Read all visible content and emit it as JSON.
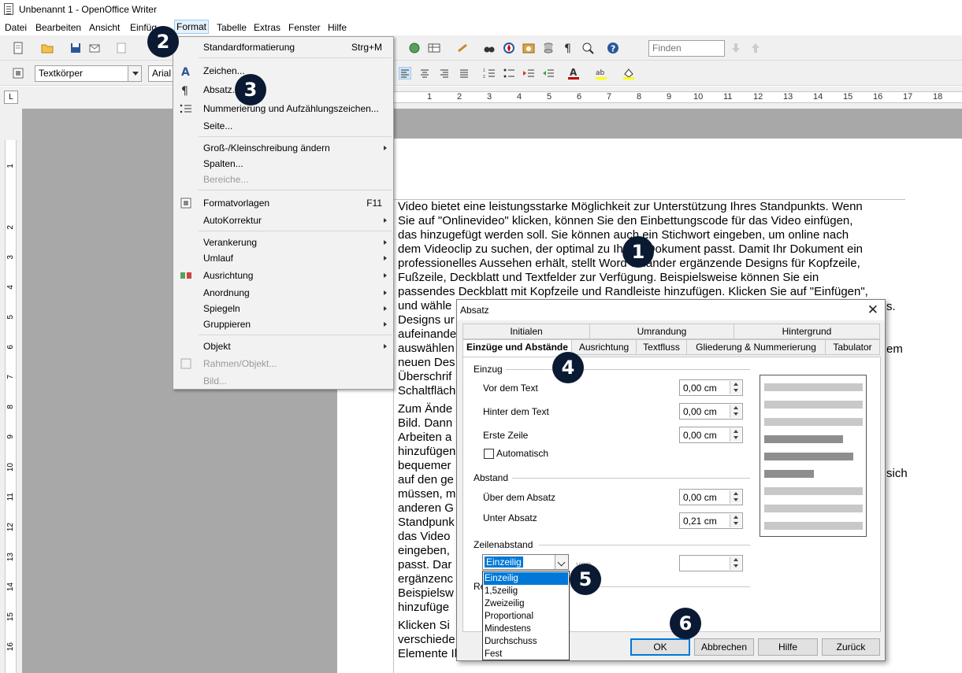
{
  "window": {
    "title": "Unbenannt 1 - OpenOffice Writer"
  },
  "menubar": [
    "Datei",
    "Bearbeiten",
    "Ansicht",
    "Einfüg",
    "Format",
    "Tabelle",
    "Extras",
    "Fenster",
    "Hilfe"
  ],
  "toolbar": {
    "paragraph_style": "Textkörper",
    "font_name": "Arial",
    "find_placeholder": "Finden"
  },
  "ruler": {
    "corner": "L",
    "numbers": [
      "1",
      "2",
      "3",
      "4",
      "5",
      "6",
      "7",
      "8",
      "9",
      "10",
      "11",
      "12",
      "13",
      "14",
      "15",
      "16",
      "17",
      "18"
    ],
    "vnumbers": [
      "1",
      "1",
      "2",
      "3",
      "4",
      "5",
      "6",
      "7",
      "8",
      "9",
      "10",
      "11",
      "12",
      "13",
      "14",
      "15",
      "16"
    ]
  },
  "format_menu": {
    "items": [
      {
        "label": "Standardformatierung",
        "shortcut": "Strg+M"
      },
      {
        "label": "Zeichen..."
      },
      {
        "label": "Absatz..."
      },
      {
        "label": "Nummerierung und Aufzählungszeichen..."
      },
      {
        "label": "Seite..."
      },
      {
        "label": "Groß-/Kleinschreibung ändern"
      },
      {
        "label": "Spalten..."
      },
      {
        "label": "Bereiche..."
      },
      {
        "label": "Formatvorlagen",
        "shortcut": "F11"
      },
      {
        "label": "AutoKorrektur"
      },
      {
        "label": "Verankerung"
      },
      {
        "label": "Umlauf"
      },
      {
        "label": "Ausrichtung"
      },
      {
        "label": "Anordnung"
      },
      {
        "label": "Spiegeln"
      },
      {
        "label": "Gruppieren"
      },
      {
        "label": "Objekt"
      },
      {
        "label": "Rahmen/Objekt..."
      },
      {
        "label": "Bild..."
      }
    ]
  },
  "document": {
    "p1": "Video bietet eine leistungsstarke Möglichkeit zur Unterstützung Ihres Standpunkts. Wenn\nSie auf \"Onlinevideo\" klicken, können Sie den Einbettungscode für das Video einfügen,\ndas hinzugefügt werden soll. Sie können auch ein Stichwort eingeben, um online nach\ndem Videoclip zu suchen, der optimal zu Ihrem Dokument passt. Damit Ihr Dokument ein\nprofessionelles Aussehen erhält, stellt Word einander ergänzende Designs für Kopfzeile,\nFußzeile, Deckblatt und Textfelder zur Verfügung. Beispielsweise können Sie ein\npassendes Deckblatt mit Kopfzeile und Randleiste hinzufügen. Klicken Sie auf \"Einfügen\",\nund wähle\nDesigns ur\naufeinande\nauswählen\nneuen Des\nÜberschrif\nSchaltfläch",
    "p2": "Zum Ände\nBild. Dann\nArbeiten a\nhinzufügen\nbequemer\nauf den ge\nmüssen, m\nanderen G\nStandpunk\ndas Video\neingeben,\npasst. Dar\nergänzenc\nBeispielsw\nhinzufüge",
    "p3": "Klicken Si\nverschiede\nElemente Ihres Dokuments aufeinander abzustimmen. Wenn Sie auf \"Entwurf\" klicken und",
    "right_frag1": "s.",
    "right_frag2": "em",
    "right_frag3": "sich"
  },
  "dialog": {
    "title": "Absatz",
    "tabs_row1": [
      "Initialen",
      "Umrandung",
      "Hintergrund"
    ],
    "tabs_row2": [
      "Einzüge und Abstände",
      "Ausrichtung",
      "Textfluss",
      "Gliederung & Nummerierung",
      "Tabulator"
    ],
    "einzug": {
      "heading": "Einzug",
      "vor_label": "Vor dem Text",
      "vor_value": "0,00 cm",
      "hinter_label": "Hinter dem Text",
      "hinter_value": "0,00 cm",
      "erste_label": "Erste Zeile",
      "erste_value": "0,00 cm",
      "auto_label": "Automatisch"
    },
    "abstand": {
      "heading": "Abstand",
      "ueber_label": "Über dem Absatz",
      "ueber_value": "0,00 cm",
      "unter_label": "Unter Absatz",
      "unter_value": "0,21 cm"
    },
    "zeilenabstand": {
      "heading": "Zeilenabstand",
      "selected": "Einzeilig",
      "von_label": "von",
      "options": [
        "Einzeilig",
        "1,5zeilig",
        "Zweizeilig",
        "Proportional",
        "Mindestens",
        "Durchschuss",
        "Fest"
      ]
    },
    "register_heading": "Re",
    "buttons": {
      "ok": "OK",
      "cancel": "Abbrechen",
      "help": "Hilfe",
      "back": "Zurück"
    }
  },
  "badges": [
    "1",
    "2",
    "3",
    "4",
    "5",
    "6"
  ],
  "colors": {
    "badge": "#0b1a33",
    "selection": "#0078d7",
    "menu_highlight": "#e5f1fb"
  }
}
